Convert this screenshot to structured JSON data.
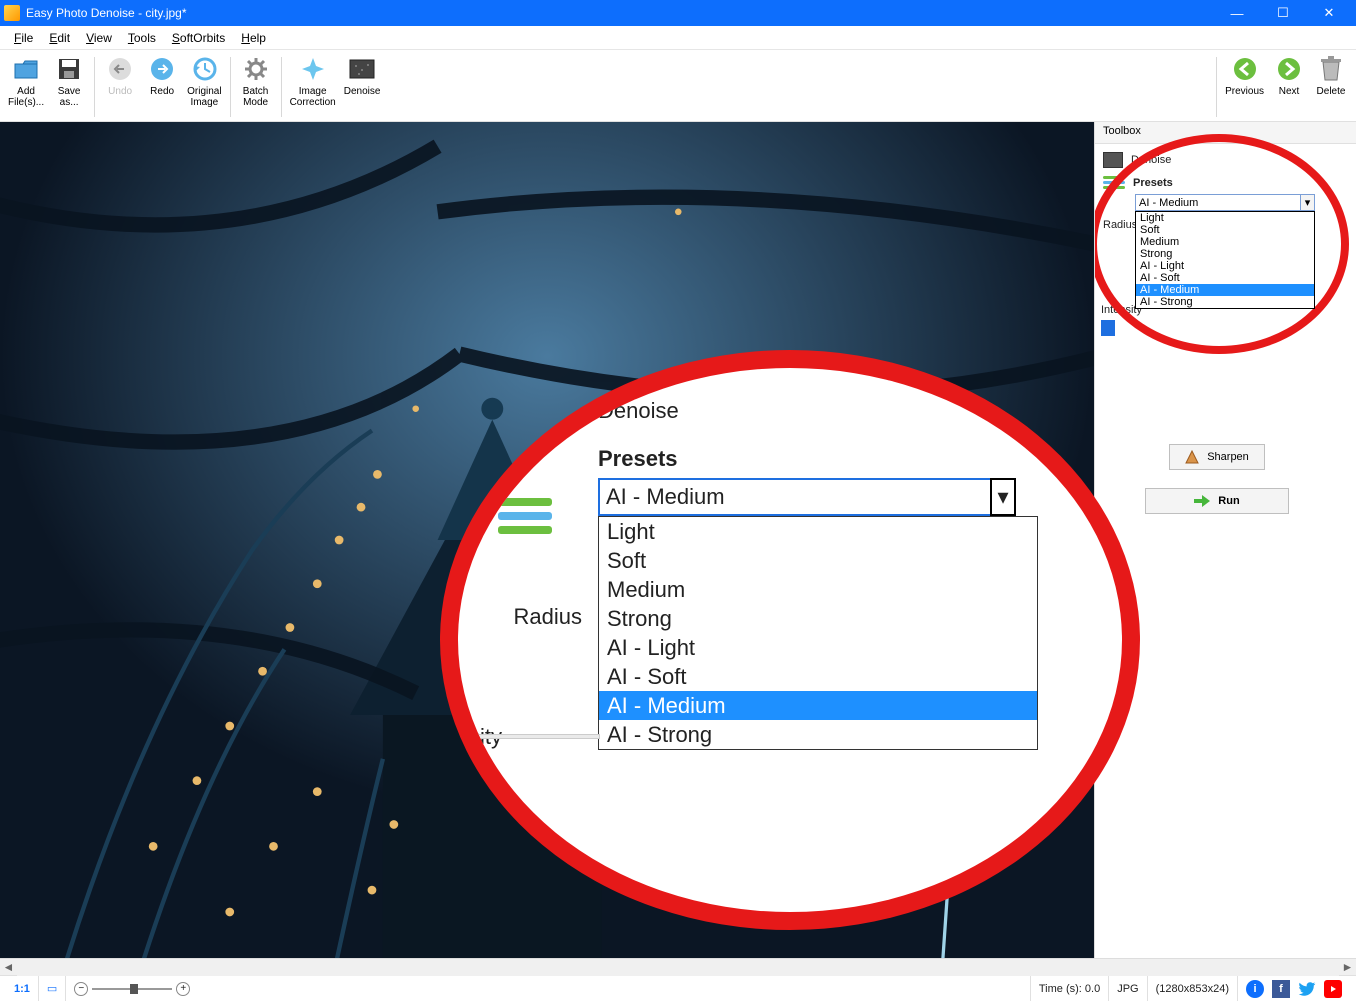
{
  "window": {
    "title": "Easy Photo Denoise - city.jpg*"
  },
  "menu": {
    "file": "File",
    "edit": "Edit",
    "view": "View",
    "tools": "Tools",
    "softorbits": "SoftOrbits",
    "help": "Help"
  },
  "toolbar": {
    "add_files": "Add\nFile(s)...",
    "save_as": "Save\nas...",
    "undo": "Undo",
    "redo": "Redo",
    "original_image": "Original\nImage",
    "batch_mode": "Batch\nMode",
    "image_correction": "Image\nCorrection",
    "denoise": "Denoise",
    "previous": "Previous",
    "next": "Next",
    "delete": "Delete"
  },
  "toolbox": {
    "title": "Toolbox",
    "section": "Denoise",
    "presets_label": "Presets",
    "selected": "AI - Medium",
    "options": [
      "Light",
      "Soft",
      "Medium",
      "Strong",
      "AI - Light",
      "AI - Soft",
      "AI - Medium",
      "AI - Strong"
    ],
    "radius": "Radius",
    "intensity": "Intensity",
    "sharpen": "Sharpen",
    "run": "Run"
  },
  "status": {
    "zoom": "1:1",
    "time": "Time (s): 0.0",
    "format": "JPG",
    "dims": "(1280x853x24)"
  }
}
